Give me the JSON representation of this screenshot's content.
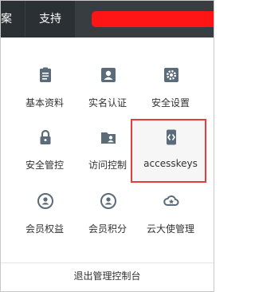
{
  "topbar": {
    "partial_item": "案",
    "support_label": "支持",
    "redaction_color": "#ff1515"
  },
  "menu": {
    "items": [
      {
        "label": "基本资料",
        "icon": "clipboard-icon"
      },
      {
        "label": "实名认证",
        "icon": "id-card-icon"
      },
      {
        "label": "安全设置",
        "icon": "gear-icon"
      },
      {
        "label": "安全管控",
        "icon": "lock-icon"
      },
      {
        "label": "访问控制",
        "icon": "folder-user-icon"
      },
      {
        "label": "accesskeys",
        "icon": "key-code-icon",
        "highlighted": true
      },
      {
        "label": "会员权益",
        "icon": "member-icon"
      },
      {
        "label": "会员积分",
        "icon": "member-points-icon"
      },
      {
        "label": "云大使管理",
        "icon": "cloud-ambassador-icon"
      }
    ],
    "highlight_color": "#e53c3c",
    "icon_color": "#5b6b79"
  },
  "footer": {
    "logout_label": "退出管理控制台"
  }
}
